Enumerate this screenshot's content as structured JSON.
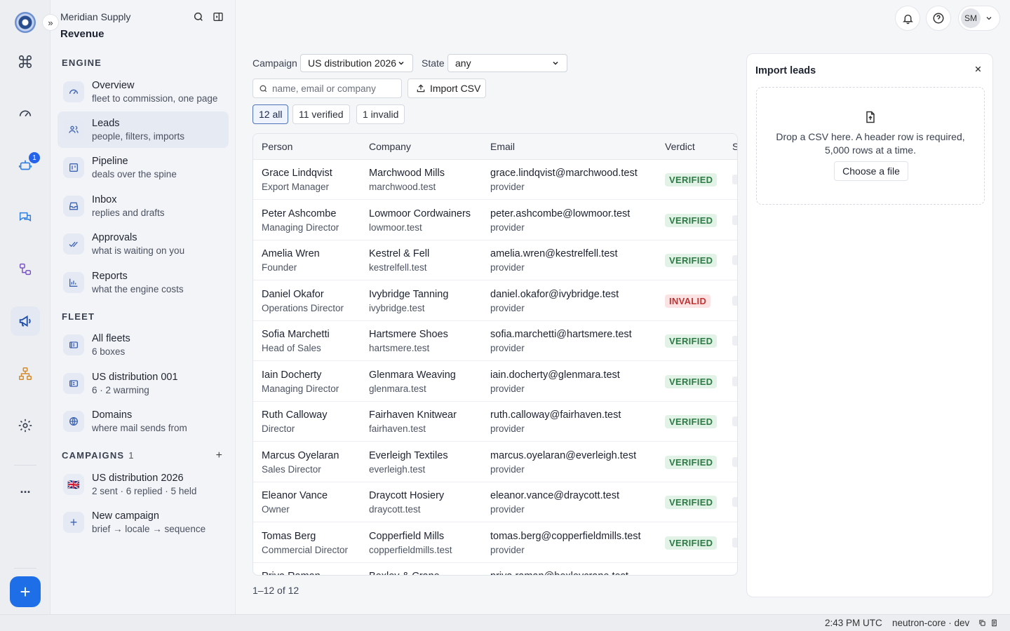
{
  "sidebar": {
    "org": "Meridian Supply",
    "app": "Revenue",
    "sections": {
      "engine": "ENGINE",
      "fleet": "FLEET",
      "campaigns": "CAMPAIGNS",
      "campaigns_count": "1"
    },
    "engine_items": [
      {
        "label": "Overview",
        "sub": "fleet to commission, one page"
      },
      {
        "label": "Leads",
        "sub": "people, filters, imports"
      },
      {
        "label": "Pipeline",
        "sub": "deals over the spine"
      },
      {
        "label": "Inbox",
        "sub": "replies and drafts"
      },
      {
        "label": "Approvals",
        "sub": "what is waiting on you"
      },
      {
        "label": "Reports",
        "sub": "what the engine costs"
      }
    ],
    "fleet_items": [
      {
        "label": "All fleets",
        "sub": "6 boxes"
      },
      {
        "label": "US distribution 001",
        "sub": "6 · 2 warming"
      },
      {
        "label": "Domains",
        "sub": "where mail sends from"
      }
    ],
    "campaign_items": [
      {
        "label": "US distribution 2026",
        "sub": "2 sent · 6 replied · 5 held",
        "flag": "🇬🇧"
      },
      {
        "label": "New campaign",
        "sub": "brief → locale → sequence"
      }
    ]
  },
  "rail": {
    "badge_count": "1",
    "fab_label": "+",
    "more_label": "···"
  },
  "header": {
    "user_initials": "SM"
  },
  "filters": {
    "campaign_label": "Campaign",
    "campaign_value": "US distribution 2026",
    "state_label": "State",
    "state_value": "any",
    "search_placeholder": "name, email or company",
    "import_label": "Import CSV",
    "chips": [
      "12 all",
      "11 verified",
      "1 invalid"
    ]
  },
  "table": {
    "columns": [
      "Person",
      "Company",
      "Email",
      "Verdict",
      "S"
    ],
    "rows": [
      {
        "name": "Grace Lindqvist",
        "title": "Export Manager",
        "company": "Marchwood Mills",
        "domain": "marchwood.test",
        "email": "grace.lindqvist@marchwood.test",
        "source": "provider",
        "verdict": "VERIFIED"
      },
      {
        "name": "Peter Ashcombe",
        "title": "Managing Director",
        "company": "Lowmoor Cordwainers",
        "domain": "lowmoor.test",
        "email": "peter.ashcombe@lowmoor.test",
        "source": "provider",
        "verdict": "VERIFIED"
      },
      {
        "name": "Amelia Wren",
        "title": "Founder",
        "company": "Kestrel & Fell",
        "domain": "kestrelfell.test",
        "email": "amelia.wren@kestrelfell.test",
        "source": "provider",
        "verdict": "VERIFIED"
      },
      {
        "name": "Daniel Okafor",
        "title": "Operations Director",
        "company": "Ivybridge Tanning",
        "domain": "ivybridge.test",
        "email": "daniel.okafor@ivybridge.test",
        "source": "provider",
        "verdict": "INVALID"
      },
      {
        "name": "Sofia Marchetti",
        "title": "Head of Sales",
        "company": "Hartsmere Shoes",
        "domain": "hartsmere.test",
        "email": "sofia.marchetti@hartsmere.test",
        "source": "provider",
        "verdict": "VERIFIED"
      },
      {
        "name": "Iain Docherty",
        "title": "Managing Director",
        "company": "Glenmara Weaving",
        "domain": "glenmara.test",
        "email": "iain.docherty@glenmara.test",
        "source": "provider",
        "verdict": "VERIFIED"
      },
      {
        "name": "Ruth Calloway",
        "title": "Director",
        "company": "Fairhaven Knitwear",
        "domain": "fairhaven.test",
        "email": "ruth.calloway@fairhaven.test",
        "source": "provider",
        "verdict": "VERIFIED"
      },
      {
        "name": "Marcus Oyelaran",
        "title": "Sales Director",
        "company": "Everleigh Textiles",
        "domain": "everleigh.test",
        "email": "marcus.oyelaran@everleigh.test",
        "source": "provider",
        "verdict": "VERIFIED"
      },
      {
        "name": "Eleanor Vance",
        "title": "Owner",
        "company": "Draycott Hosiery",
        "domain": "draycott.test",
        "email": "eleanor.vance@draycott.test",
        "source": "provider",
        "verdict": "VERIFIED"
      },
      {
        "name": "Tomas Berg",
        "title": "Commercial Director",
        "company": "Copperfield Mills",
        "domain": "copperfieldmills.test",
        "email": "tomas.berg@copperfieldmills.test",
        "source": "provider",
        "verdict": "VERIFIED"
      },
      {
        "name": "Priya Raman",
        "title": "",
        "company": "Bexley & Crane",
        "domain": "",
        "email": "priya.raman@bexleycrane.test",
        "source": "",
        "verdict": ""
      }
    ],
    "pager": "1–12 of 12"
  },
  "import_panel": {
    "title": "Import leads",
    "drop_text": "Drop a CSV here. A header row is required, 5,000 rows at a time.",
    "choose_label": "Choose a file"
  },
  "statusbar": {
    "time": "2:43 PM UTC",
    "env": "neutron-core · dev"
  },
  "colors": {
    "accent": "#1e6ee8",
    "verified_bg": "#e2f2e6",
    "verified_fg": "#2c7a44",
    "invalid_bg": "#fbe3e3",
    "invalid_fg": "#c03434"
  }
}
